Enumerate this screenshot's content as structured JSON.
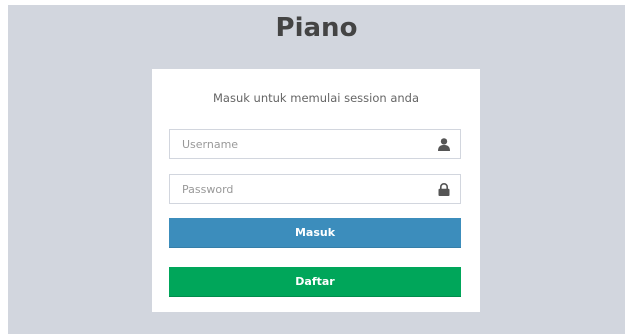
{
  "colors": {
    "page_background": "#d2d6de",
    "primary_button": "#3c8dbc",
    "success_button": "#00a65a"
  },
  "logo": {
    "text": "Piano"
  },
  "login_box": {
    "message": "Masuk untuk memulai session anda",
    "username": {
      "placeholder": "Username",
      "value": "",
      "icon": "user-icon"
    },
    "password": {
      "placeholder": "Password",
      "value": "",
      "icon": "lock-icon"
    },
    "masuk_label": "Masuk",
    "daftar_label": "Daftar"
  }
}
